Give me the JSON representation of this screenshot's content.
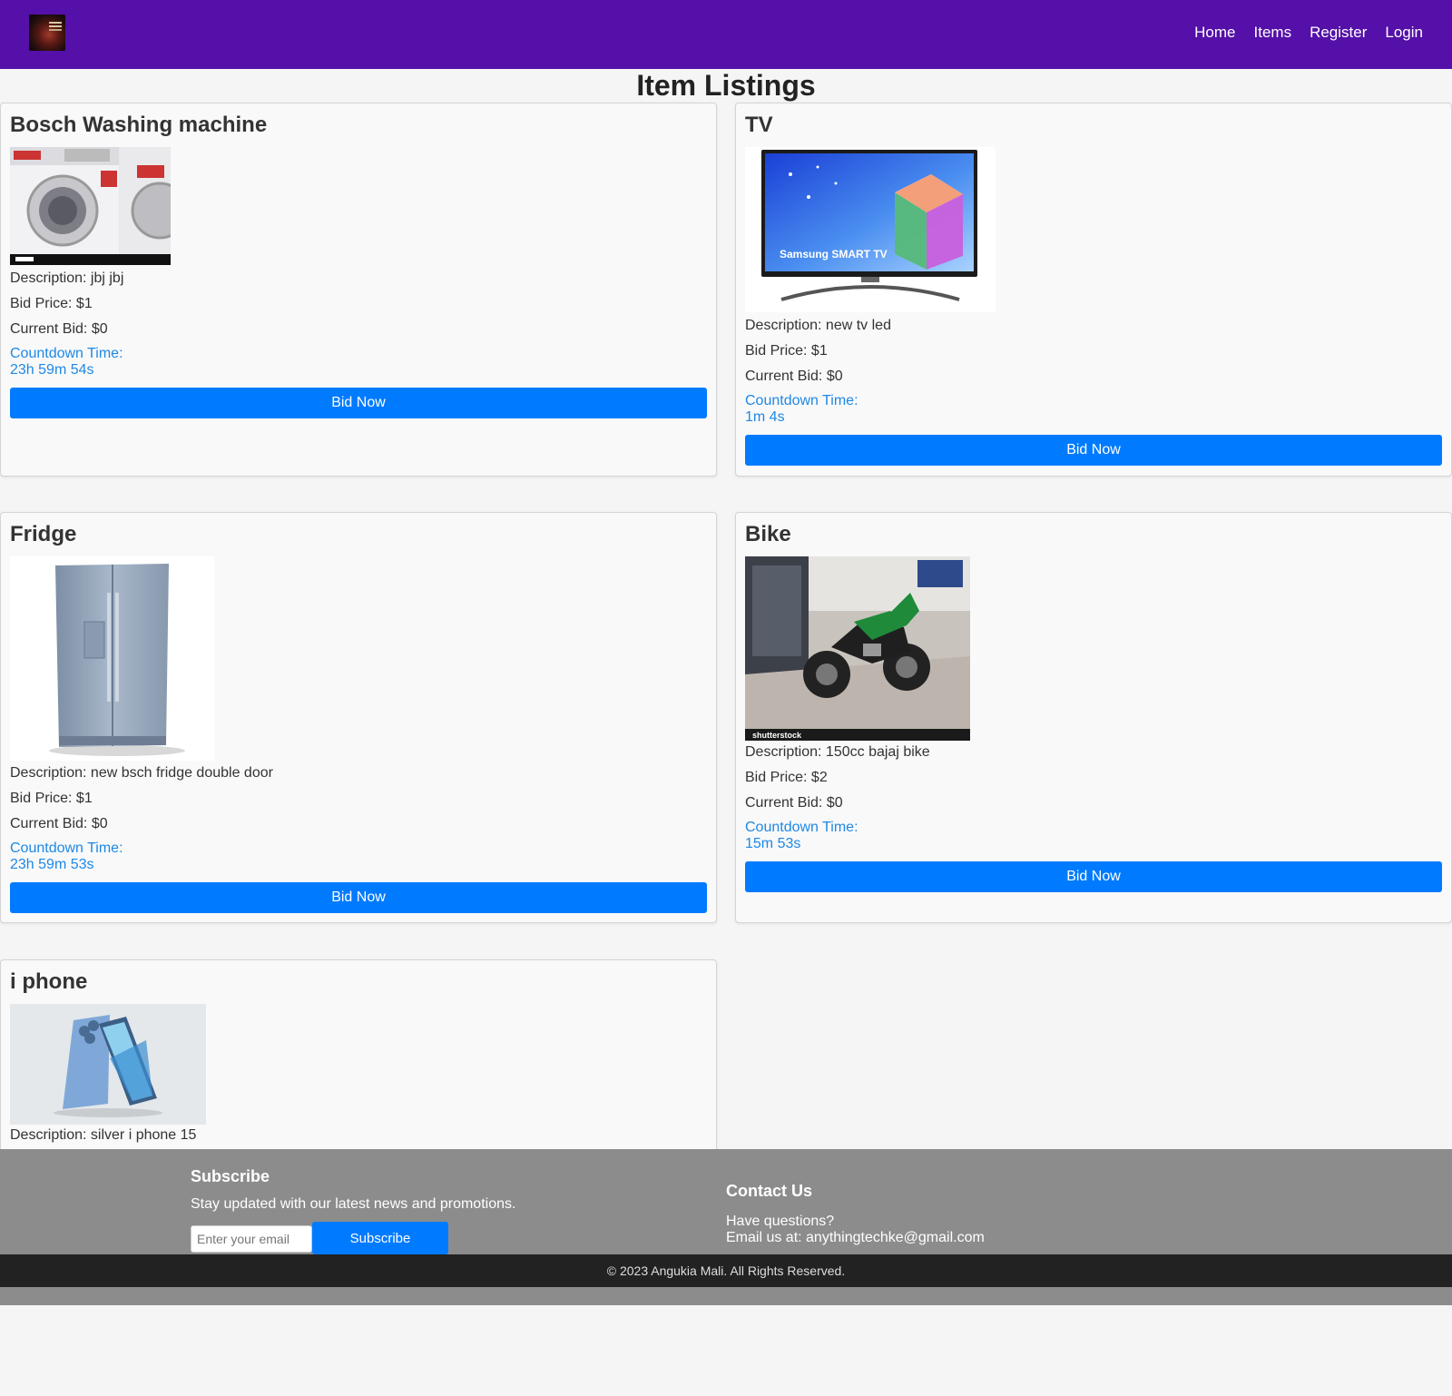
{
  "nav": {
    "links": [
      "Home",
      "Items",
      "Register",
      "Login"
    ]
  },
  "page_title": "Item Listings",
  "labels": {
    "description": "Description:",
    "bid_price": "Bid Price:",
    "current_bid": "Current Bid:",
    "countdown": "Countdown Time:",
    "bid_button": "Bid Now"
  },
  "items": [
    {
      "title": "Bosch Washing machine",
      "description": "Description: jbj jbj",
      "bid_price": "Bid Price: $1",
      "current_bid": "Current Bid: $0",
      "countdown_label": "Countdown Time:",
      "countdown": "23h 59m 54s",
      "button": "Bid Now"
    },
    {
      "title": "TV",
      "description": "Description: new tv led",
      "bid_price": "Bid Price: $1",
      "current_bid": "Current Bid: $0",
      "countdown_label": "Countdown Time:",
      "countdown": "1m 4s",
      "button": "Bid Now",
      "image_text": "Samsung SMART TV"
    },
    {
      "title": "Fridge",
      "description": "Description: new bsch fridge double door",
      "bid_price": "Bid Price: $1",
      "current_bid": "Current Bid: $0",
      "countdown_label": "Countdown Time:",
      "countdown": "23h 59m 53s",
      "button": "Bid Now"
    },
    {
      "title": "Bike",
      "description": "Description: 150cc bajaj bike",
      "bid_price": "Bid Price: $2",
      "current_bid": "Current Bid: $0",
      "countdown_label": "Countdown Time:",
      "countdown": "15m 53s",
      "button": "Bid Now",
      "image_text": "shutterstock"
    },
    {
      "title": "i phone",
      "description": "Description: silver i phone 15"
    }
  ],
  "footer": {
    "subscribe_title": "Subscribe",
    "subscribe_text": "Stay updated with our latest news and promotions.",
    "email_placeholder": "Enter your email",
    "subscribe_button": "Subscribe",
    "contact_title": "Contact Us",
    "contact_line1": "Have questions?",
    "contact_line2": "Email us at: anythingtechke@gmail.com",
    "copyright": "© 2023 Angukia Mali. All Rights Reserved."
  },
  "colors": {
    "navbar": "#5410a8",
    "button": "#007bff",
    "countdown": "#1e88e5",
    "footer": "#8c8c8c",
    "copyright_bar": "#222222"
  }
}
